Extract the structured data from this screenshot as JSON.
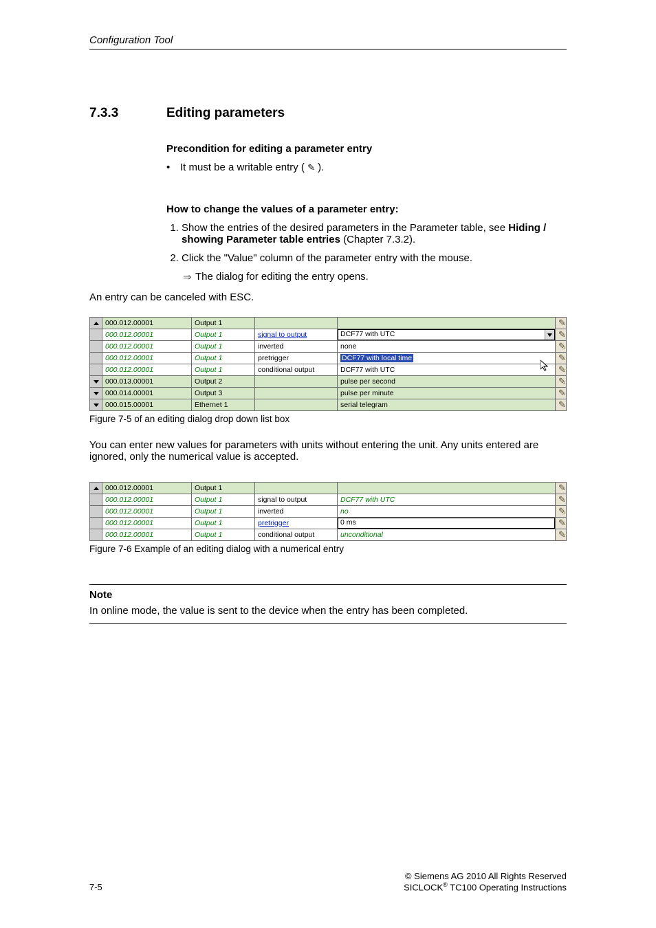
{
  "running_head": "Configuration Tool",
  "section": {
    "num": "7.3.3",
    "title": "Editing parameters"
  },
  "precond": {
    "heading": "Precondition for editing a parameter entry",
    "bullet_pre": "It must be a writable entry ( ",
    "bullet_post": " )."
  },
  "howto": {
    "heading": "How to change the values of a parameter entry:",
    "step1_pre": "Show the entries of the desired parameters in the Parameter table, see ",
    "step1_bold": "Hiding / showing Parameter table entries",
    "step1_post": " (Chapter 7.3.2).",
    "step2": "Click the \"Value\" column of the parameter entry with the mouse.",
    "result": "The dialog for editing the entry opens.",
    "cancel": "An entry can be canceled with ESC."
  },
  "fig1": {
    "caption": "Figure 7-5 of an editing dialog drop down list box",
    "rows": [
      {
        "handle": "up",
        "cls": "row-green",
        "id": "000.012.00001",
        "grp": "Output 1",
        "name": "",
        "val": "",
        "italic": false,
        "valtype": "plain",
        "edit": true
      },
      {
        "handle": "",
        "cls": "row-white",
        "id": "000.012.00001",
        "grp": "Output 1",
        "name": "signal to output",
        "name_link": true,
        "val": "DCF77 with UTC",
        "italic": true,
        "valtype": "dropdown",
        "edit": true
      },
      {
        "handle": "",
        "cls": "row-white",
        "id": "000.012.00001",
        "grp": "Output 1",
        "name": "inverted",
        "name_link": false,
        "val": "none",
        "italic": true,
        "valtype": "listitem",
        "edit": true
      },
      {
        "handle": "",
        "cls": "row-white",
        "id": "000.012.00001",
        "grp": "Output 1",
        "name": "pretrigger",
        "name_link": false,
        "val": "DCF77 with local time",
        "italic": true,
        "valtype": "highlight",
        "edit": true
      },
      {
        "handle": "",
        "cls": "row-white",
        "id": "000.012.00001",
        "grp": "Output 1",
        "name": "conditional output",
        "name_link": false,
        "val": "DCF77 with UTC",
        "italic": true,
        "valtype": "listitem_cursor",
        "edit": true
      },
      {
        "handle": "down",
        "cls": "row-green",
        "id": "000.013.00001",
        "grp": "Output 2",
        "name": "",
        "val": "pulse per second",
        "italic": false,
        "valtype": "listitem",
        "edit": true
      },
      {
        "handle": "down",
        "cls": "row-green",
        "id": "000.014.00001",
        "grp": "Output 3",
        "name": "",
        "val": "pulse per minute",
        "italic": false,
        "valtype": "listitem",
        "edit": true
      },
      {
        "handle": "down",
        "cls": "row-green",
        "id": "000.015.00001",
        "grp": "Ethernet 1",
        "name": "",
        "val": "serial telegram",
        "italic": false,
        "valtype": "listitem",
        "edit": true
      }
    ]
  },
  "mid_para": "You can enter new values for parameters with units without entering the unit. Any units entered are ignored, only the numerical value is accepted.",
  "fig2": {
    "caption": "Figure 7-6 Example of an editing dialog with a numerical entry",
    "rows": [
      {
        "handle": "up",
        "cls": "row-green",
        "id": "000.012.00001",
        "grp": "Output 1",
        "name": "",
        "val": "",
        "italic": false,
        "valtype": "plain",
        "edit": true
      },
      {
        "handle": "",
        "cls": "row-white",
        "id": "000.012.00001",
        "grp": "Output 1",
        "name": "signal to output",
        "name_link": false,
        "val": "DCF77 with UTC",
        "italic": true,
        "valtype": "text",
        "edit": true
      },
      {
        "handle": "",
        "cls": "row-white",
        "id": "000.012.00001",
        "grp": "Output 1",
        "name": "inverted",
        "name_link": false,
        "val": "no",
        "italic": true,
        "valtype": "text",
        "edit": true
      },
      {
        "handle": "",
        "cls": "row-white",
        "id": "000.012.00001",
        "grp": "Output 1",
        "name": "pretrigger",
        "name_link": true,
        "val": "0 ms",
        "italic": true,
        "valtype": "input",
        "edit": true
      },
      {
        "handle": "",
        "cls": "row-white",
        "id": "000.012.00001",
        "grp": "Output 1",
        "name": "conditional output",
        "name_link": false,
        "val": "unconditional",
        "italic": true,
        "valtype": "text",
        "edit": true
      }
    ]
  },
  "note": {
    "label": "Note",
    "text": "In online mode, the value is sent to the device when the entry has been completed."
  },
  "footer": {
    "page": "7-5",
    "copyright": "©  Siemens AG 2010 All Rights Reserved",
    "product_pre": "SICLOCK",
    "product_sup": "®",
    "product_post": " TC100 Operating Instructions"
  },
  "chart_data": null
}
